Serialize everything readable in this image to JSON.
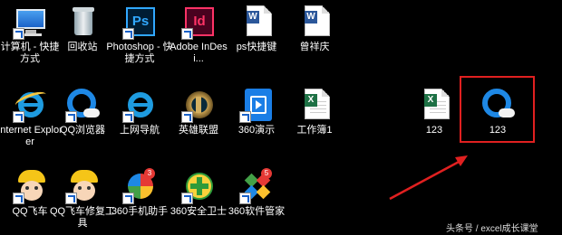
{
  "icons": [
    {
      "id": "computer",
      "label": "计算机 - 快捷方式"
    },
    {
      "id": "recycle",
      "label": "回收站"
    },
    {
      "id": "photoshop",
      "label": "Photoshop - 快捷方式"
    },
    {
      "id": "indesign",
      "label": "Adobe InDesi..."
    },
    {
      "id": "ps-doc",
      "label": "ps快捷键"
    },
    {
      "id": "word-doc",
      "label": "曾祥庆"
    },
    {
      "id": "ie",
      "label": "Internet Explorer"
    },
    {
      "id": "qqbrowser",
      "label": "QQ浏览器"
    },
    {
      "id": "nav",
      "label": "上网导航"
    },
    {
      "id": "lol",
      "label": "英雄联盟"
    },
    {
      "id": "360show",
      "label": "360演示"
    },
    {
      "id": "excel1",
      "label": "工作簿1"
    },
    {
      "id": "excel123",
      "label": "123"
    },
    {
      "id": "qq123",
      "label": "123"
    },
    {
      "id": "qqcar",
      "label": "QQ飞车"
    },
    {
      "id": "qqcarfix",
      "label": "QQ飞车修复工具"
    },
    {
      "id": "360phone",
      "label": "360手机助手"
    },
    {
      "id": "360safe",
      "label": "360安全卫士"
    },
    {
      "id": "360soft",
      "label": "360软件管家"
    }
  ],
  "badges": {
    "phone": "3",
    "soft": "5"
  },
  "app_glyphs": {
    "ps": "Ps",
    "id": "Id",
    "word": "W",
    "excel": "X"
  },
  "watermark": "头条号 / excel成长课堂",
  "colors": {
    "highlight": "#e02020",
    "qq_blue": "#1e88e5",
    "arrow_red": "#e02020"
  }
}
